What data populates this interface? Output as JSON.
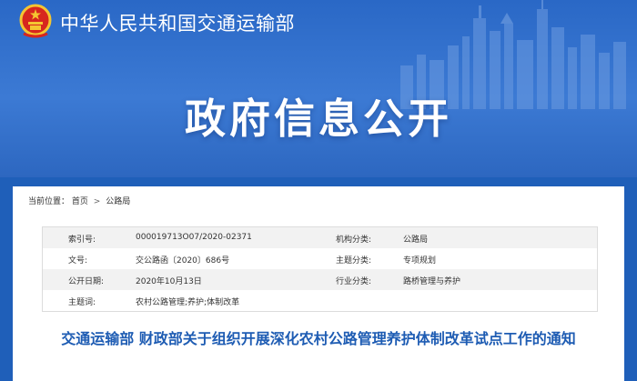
{
  "header": {
    "ministry_name": "中华人民共和国交通运输部",
    "banner_title": "政府信息公开",
    "icons": {
      "emblem": "national-emblem-icon",
      "skyline": "city-skyline-image"
    },
    "colors": {
      "banner": "#2a68c6",
      "accent_text": "#1e5cb3"
    }
  },
  "breadcrumb": {
    "label": "当前位置：",
    "items": [
      "首页",
      "公路局"
    ],
    "separator": ">"
  },
  "metadata": {
    "rows": [
      {
        "key1": "索引号:",
        "value1": "000019713O07/2020-02371",
        "key2": "机构分类:",
        "value2": "公路局"
      },
      {
        "key1": "文号:",
        "value1": "交公路函〔2020〕686号",
        "key2": "主题分类:",
        "value2": "专项规划"
      },
      {
        "key1": "公开日期:",
        "value1": "2020年10月13日",
        "key2": "行业分类:",
        "value2": "路桥管理与养护"
      },
      {
        "key1": "主题词:",
        "value1": "农村公路管理;养护;体制改革",
        "key2": "",
        "value2": ""
      }
    ]
  },
  "document": {
    "title": "交通运输部 财政部关于组织开展深化农村公路管理养护体制改革试点工作的通知"
  }
}
